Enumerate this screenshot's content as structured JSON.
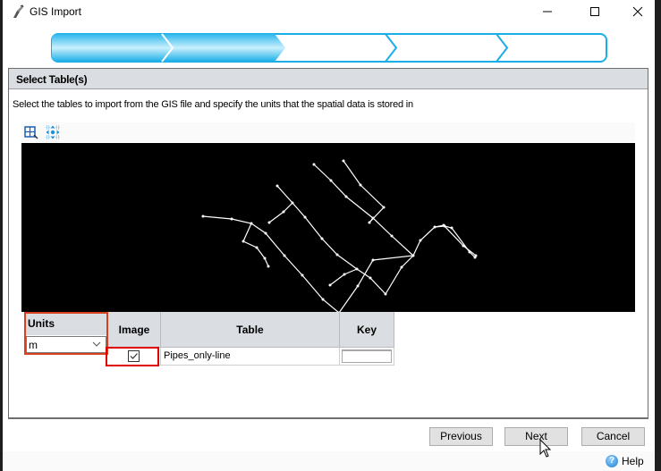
{
  "window": {
    "title": "GIS Import",
    "controls": {
      "minimize": "minimize",
      "maximize": "maximize",
      "close": "close"
    }
  },
  "wizard_progress": {
    "total_steps": 5,
    "completed_steps": 2,
    "accent_color": "#1aaee8"
  },
  "section": {
    "title": "Select Table(s)",
    "description": "Select the tables to import from the GIS file and specify the units that the spatial data is stored in"
  },
  "map_toolbar": {
    "tools": [
      {
        "name": "zoom-to-extent",
        "icon": "zoom-extent-icon"
      },
      {
        "name": "pan",
        "icon": "pan-icon"
      }
    ]
  },
  "map_preview": {
    "background": "#000000",
    "line_color": "#ffffff",
    "description": "Pipe network line preview"
  },
  "units": {
    "label": "Units",
    "selected": "m"
  },
  "table": {
    "columns": [
      "Image",
      "Table",
      "Key"
    ],
    "rows": [
      {
        "image_checked": true,
        "table": "Pipes_only-line",
        "key": ""
      }
    ]
  },
  "buttons": {
    "previous": "Previous",
    "next": "Next",
    "cancel": "Cancel",
    "help": "Help"
  },
  "highlights": {
    "color": "#e00000"
  }
}
